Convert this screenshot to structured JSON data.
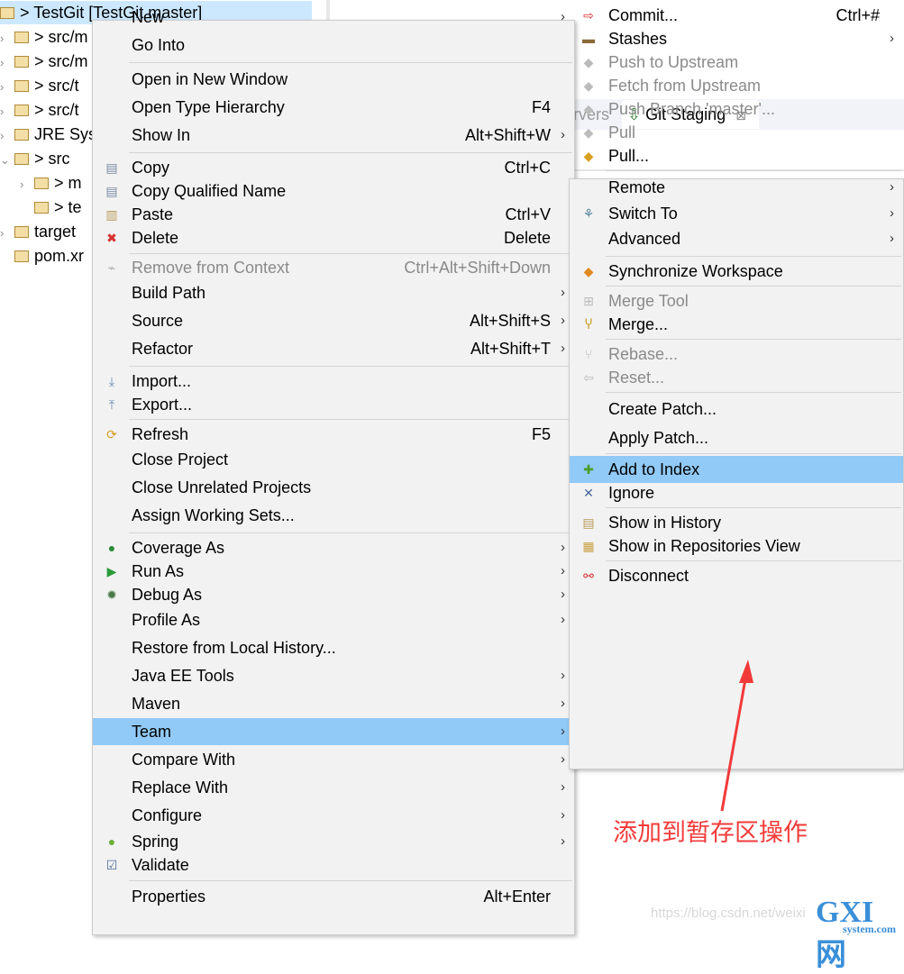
{
  "tree": [
    {
      "label": "> TestGit [TestGit master]",
      "twisty": "",
      "selected": true
    },
    {
      "label": "> src/m",
      "twisty": "›"
    },
    {
      "label": "> src/m",
      "twisty": "›"
    },
    {
      "label": "> src/t",
      "twisty": "›"
    },
    {
      "label": "> src/t",
      "twisty": "›"
    },
    {
      "label": "JRE Sys",
      "twisty": "›"
    },
    {
      "label": "> src",
      "twisty": "⌄"
    },
    {
      "label": "> m",
      "twisty": "›"
    },
    {
      "label": "> te",
      "twisty": ""
    },
    {
      "label": "target",
      "twisty": "›"
    },
    {
      "label": "pom.xr",
      "twisty": ""
    }
  ],
  "tabs": {
    "servers": "ervers",
    "git_staging": "Git Staging",
    "close": "⊠"
  },
  "main_menu": [
    {
      "label": "New",
      "arrow": true
    },
    {
      "label": "Go Into"
    },
    {
      "sep": true
    },
    {
      "label": "Open in New Window"
    },
    {
      "label": "Open Type Hierarchy",
      "shortcut": "F4"
    },
    {
      "label": "Show In",
      "shortcut": "Alt+Shift+W",
      "arrow": true
    },
    {
      "sep": true
    },
    {
      "label": "Copy",
      "shortcut": "Ctrl+C",
      "icon": "copy-icon",
      "glyph": "▤",
      "color": "#7a8aa0"
    },
    {
      "label": "Copy Qualified Name",
      "icon": "copy-qualified-icon",
      "glyph": "▤",
      "color": "#7a8aa0"
    },
    {
      "label": "Paste",
      "shortcut": "Ctrl+V",
      "icon": "paste-icon",
      "glyph": "▥",
      "color": "#b89a5a"
    },
    {
      "label": "Delete",
      "shortcut": "Delete",
      "icon": "delete-icon",
      "glyph": "✖",
      "color": "#d83030"
    },
    {
      "sep": true
    },
    {
      "label": "Remove from Context",
      "shortcut": "Ctrl+Alt+Shift+Down",
      "disabled": true,
      "icon": "remove-context-icon",
      "glyph": "⌁",
      "color": "#aaa"
    },
    {
      "label": "Build Path",
      "arrow": true
    },
    {
      "label": "Source",
      "shortcut": "Alt+Shift+S",
      "arrow": true
    },
    {
      "label": "Refactor",
      "shortcut": "Alt+Shift+T",
      "arrow": true
    },
    {
      "sep": true
    },
    {
      "label": "Import...",
      "icon": "import-icon",
      "glyph": "⤓",
      "color": "#6a8ab0"
    },
    {
      "label": "Export...",
      "icon": "export-icon",
      "glyph": "⤒",
      "color": "#6a8ab0"
    },
    {
      "sep": true
    },
    {
      "label": "Refresh",
      "shortcut": "F5",
      "icon": "refresh-icon",
      "glyph": "⟳",
      "color": "#d89a20"
    },
    {
      "label": "Close Project"
    },
    {
      "label": "Close Unrelated Projects"
    },
    {
      "label": "Assign Working Sets..."
    },
    {
      "sep": true
    },
    {
      "label": "Coverage As",
      "arrow": true,
      "icon": "coverage-icon",
      "glyph": "●",
      "color": "#2a8a3a"
    },
    {
      "label": "Run As",
      "arrow": true,
      "icon": "run-icon",
      "glyph": "▶",
      "color": "#2a9a3a"
    },
    {
      "label": "Debug As",
      "arrow": true,
      "icon": "debug-icon",
      "glyph": "✹",
      "color": "#4a7a4a"
    },
    {
      "label": "Profile As",
      "arrow": true
    },
    {
      "label": "Restore from Local History..."
    },
    {
      "label": "Java EE Tools",
      "arrow": true
    },
    {
      "label": "Maven",
      "arrow": true
    },
    {
      "label": "Team",
      "arrow": true,
      "highlighted": true
    },
    {
      "label": "Compare With",
      "arrow": true
    },
    {
      "label": "Replace With",
      "arrow": true
    },
    {
      "label": "Configure",
      "arrow": true
    },
    {
      "label": "Spring",
      "arrow": true,
      "icon": "spring-icon",
      "glyph": "●",
      "color": "#6ab03a"
    },
    {
      "label": "Validate",
      "icon": "validate-checkbox-icon",
      "glyph": "☑",
      "color": "#4a6a9a"
    },
    {
      "sep": true
    },
    {
      "label": "Properties",
      "shortcut": "Alt+Enter"
    }
  ],
  "team_menu": [
    {
      "label": "Commit...",
      "shortcut": "Ctrl+#",
      "icon": "commit-icon",
      "glyph": "⇨",
      "color": "#d83030"
    },
    {
      "label": "Stashes",
      "arrow": true,
      "icon": "stashes-icon",
      "glyph": "▬",
      "color": "#8a6a3a"
    },
    {
      "label": "Push to Upstream",
      "disabled": true,
      "icon": "push-icon",
      "glyph": "◆",
      "color": "#bbb"
    },
    {
      "label": "Fetch from Upstream",
      "disabled": true,
      "icon": "fetch-icon",
      "glyph": "◆",
      "color": "#bbb"
    },
    {
      "label": "Push Branch 'master'...",
      "disabled": true,
      "icon": "push-branch-icon",
      "glyph": "◆",
      "color": "#bbb"
    },
    {
      "label": "Pull",
      "disabled": true,
      "icon": "pull-icon",
      "glyph": "◆",
      "color": "#bbb"
    },
    {
      "label": "Pull...",
      "icon": "pull-dialog-icon",
      "glyph": "◆",
      "color": "#d8a020"
    },
    {
      "sep": true
    },
    {
      "label": "Remote",
      "arrow": true
    },
    {
      "label": "Switch To",
      "arrow": true,
      "icon": "switch-branch-icon",
      "glyph": "⚘",
      "color": "#5a8aa0"
    },
    {
      "label": "Advanced",
      "arrow": true
    },
    {
      "sep": true
    },
    {
      "label": "Synchronize Workspace",
      "icon": "synchronize-icon",
      "glyph": "◆",
      "color": "#e08a20"
    },
    {
      "sep": true
    },
    {
      "label": "Merge Tool",
      "disabled": true,
      "icon": "merge-tool-icon",
      "glyph": "⊞",
      "color": "#bbb"
    },
    {
      "label": "Merge...",
      "icon": "merge-icon",
      "glyph": "Ⴤ",
      "color": "#c89a20"
    },
    {
      "sep": true
    },
    {
      "label": "Rebase...",
      "disabled": true,
      "icon": "rebase-icon",
      "glyph": "⑂",
      "color": "#bbb"
    },
    {
      "label": "Reset...",
      "disabled": true,
      "icon": "reset-icon",
      "glyph": "⇦",
      "color": "#bbb"
    },
    {
      "sep": true
    },
    {
      "label": "Create Patch..."
    },
    {
      "label": "Apply Patch..."
    },
    {
      "sep": true
    },
    {
      "label": "Add to Index",
      "highlighted": true,
      "icon": "add-icon",
      "glyph": "✚",
      "color": "#4aa02a"
    },
    {
      "label": "Ignore",
      "icon": "ignore-icon",
      "glyph": "✕",
      "color": "#4a6a9a"
    },
    {
      "sep": true
    },
    {
      "label": "Show in History",
      "icon": "history-icon",
      "glyph": "▤",
      "color": "#b89a5a"
    },
    {
      "label": "Show in Repositories View",
      "icon": "repositories-icon",
      "glyph": "▦",
      "color": "#c8a040"
    },
    {
      "sep": true
    },
    {
      "label": "Disconnect",
      "icon": "disconnect-icon",
      "glyph": "⚯",
      "color": "#d83030"
    }
  ],
  "annotation": {
    "text": "添加到暂存区操作",
    "color": "#f23a3a"
  },
  "watermark": {
    "url": "https://blog.csdn.net/weixi",
    "logo": "GXI网",
    "logo_sub": "system.com"
  }
}
